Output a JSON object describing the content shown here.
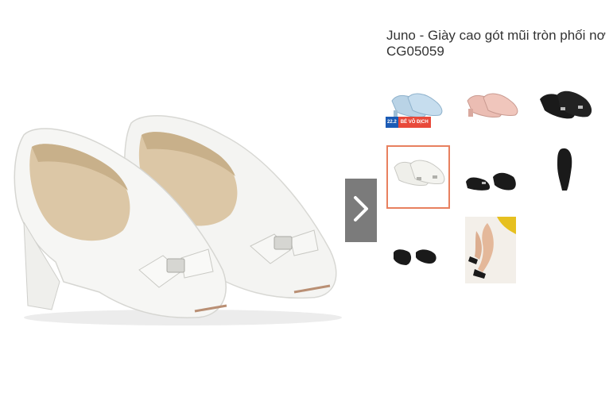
{
  "product": {
    "title": "Juno - Giày cao gót mũi tròn phối nơ CG05059"
  },
  "gallery": {
    "next_icon": "chevron-right-icon",
    "selected_index": 3,
    "thumbnails": [
      {
        "name": "blue-pair",
        "color": "#b9d3e6"
      },
      {
        "name": "pink-pair",
        "color": "#ebbdb3"
      },
      {
        "name": "black-pair",
        "color": "#1a1a1a"
      },
      {
        "name": "white-pair",
        "color": "#efefea"
      },
      {
        "name": "black-pair-side",
        "color": "#1a1a1a"
      },
      {
        "name": "black-sole",
        "color": "#1a1a1a"
      },
      {
        "name": "black-pair-back",
        "color": "#1a1a1a"
      },
      {
        "name": "model-wearing",
        "color": "#e6c020"
      }
    ],
    "promo_badge": {
      "left": "22.2",
      "right": "BÉ VÔ ĐỊCH"
    }
  },
  "colors": {
    "selected_border": "#e8805f",
    "next_button_bg": "#7b7b7b"
  }
}
